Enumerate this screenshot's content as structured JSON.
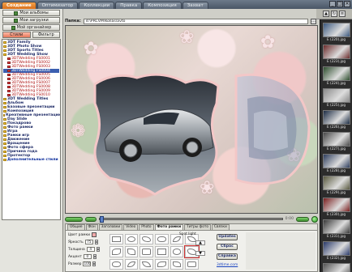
{
  "tabs": [
    "Создание",
    "Оптимизатор",
    "Коллекции",
    "Правка",
    "Композиция",
    "Захват"
  ],
  "active_tab": 0,
  "left": {
    "button_top": "Мои альбомы",
    "button_load": "Мои загрузки",
    "button_organizer": "Мой органайзер",
    "toggle_a": "Стили",
    "toggle_b": "Фильтр"
  },
  "tree": [
    {
      "label": "3DT Family",
      "type": "root"
    },
    {
      "label": "3DT Photo Show",
      "type": "root"
    },
    {
      "label": "3DT Sports Titles",
      "type": "root"
    },
    {
      "label": "3DT Wedding Show",
      "type": "root"
    },
    {
      "label": "3DTWedding FS0001",
      "type": "child"
    },
    {
      "label": "3DTWedding FS0002",
      "type": "child"
    },
    {
      "label": "3DTWedding FS0003",
      "type": "child"
    },
    {
      "label": "3DTWedding FS0004",
      "type": "child",
      "selected": true
    },
    {
      "label": "3DTWedding FS0005",
      "type": "child"
    },
    {
      "label": "3DTWedding FS0006",
      "type": "child"
    },
    {
      "label": "3DTWedding FS0007",
      "type": "child"
    },
    {
      "label": "3DTWedding FS0008",
      "type": "child"
    },
    {
      "label": "3DTWedding FS0009",
      "type": "child"
    },
    {
      "label": "3DTWedding FS0010",
      "type": "child"
    },
    {
      "label": "3DT Wedding Titles",
      "type": "root"
    },
    {
      "label": "Альбом",
      "type": "root"
    },
    {
      "label": "Базовые презентации",
      "type": "root"
    },
    {
      "label": "Композиция",
      "type": "root"
    },
    {
      "label": "Креативные презентации",
      "type": "root"
    },
    {
      "label": "Day Slide",
      "type": "root"
    },
    {
      "label": "Покадрово",
      "type": "root"
    },
    {
      "label": "Фото рамки",
      "type": "root"
    },
    {
      "label": "Игра",
      "type": "root"
    },
    {
      "label": "Рамки игр",
      "type": "root"
    },
    {
      "label": "Движение",
      "type": "root"
    },
    {
      "label": "Вращение",
      "type": "root"
    },
    {
      "label": "Фото сфера",
      "type": "root"
    },
    {
      "label": "Причина года",
      "type": "root"
    },
    {
      "label": "Протектор",
      "type": "root"
    },
    {
      "label": "Дополнительные стили",
      "type": "last"
    }
  ],
  "address": {
    "label": "Папка:",
    "path": "d:\\PRCVM\\Kollas\\avto"
  },
  "slider": {
    "time": "0:00"
  },
  "settings": {
    "tabs": [
      "Общие",
      "Фон",
      "Заголовки",
      "Video",
      "Photo",
      "Фото рамки",
      "Титры фото",
      "Связки"
    ],
    "active_tab": 5,
    "fields": [
      {
        "label": "Цвет рамки",
        "value": ""
      },
      {
        "label": "Яркость",
        "value": "75"
      },
      {
        "label": "Толщина",
        "value": "4"
      },
      {
        "label": "Акцент",
        "value": "0"
      },
      {
        "label": "Размер",
        "value": "100"
      }
    ],
    "frame_label": "Spot light",
    "buttons": [
      "Updates",
      "Сброс",
      "Справка"
    ],
    "link": "3dtime.com"
  },
  "thumbs": [
    {
      "caption": "E (220).jpg",
      "color": "#3d5a80"
    },
    {
      "caption": "E (223).jpg",
      "color": "#6b2c2c"
    },
    {
      "caption": "E (224).jpg",
      "color": "#2f4f2f"
    },
    {
      "caption": "E (225).jpg",
      "color": "#8a8a8a"
    },
    {
      "caption": "E (226).jpg",
      "color": "#1c2c44"
    },
    {
      "caption": "E (227).jpg",
      "color": "#4a4a4a"
    },
    {
      "caption": "E (228).jpg",
      "color": "#2e3e5e"
    },
    {
      "caption": "E (229).jpg",
      "color": "#5a5a40"
    },
    {
      "caption": "E (230).jpg",
      "color": "#7a2020"
    },
    {
      "caption": "E (231).jpg",
      "color": "#3a3a3a"
    },
    {
      "caption": "E (232).jpg",
      "color": "#2a3a6a"
    },
    {
      "caption": "E (233).jpg",
      "color": "#555555"
    }
  ]
}
